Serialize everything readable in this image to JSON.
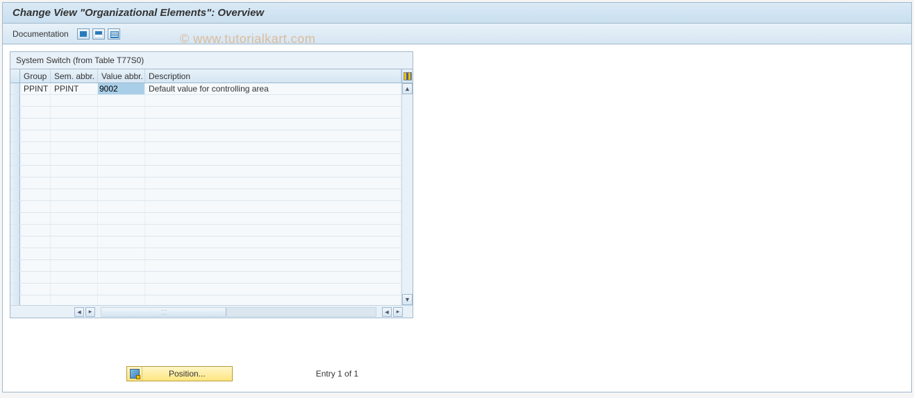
{
  "title": "Change View \"Organizational Elements\": Overview",
  "toolbar": {
    "documentation_label": "Documentation"
  },
  "watermark": "© www.tutorialkart.com",
  "panel": {
    "title": "System Switch (from Table T77S0)",
    "columns": {
      "group": "Group",
      "sem_abbr": "Sem. abbr.",
      "value_abbr": "Value abbr.",
      "description": "Description"
    },
    "rows": [
      {
        "group": "PPINT",
        "sem_abbr": "PPINT",
        "value_abbr": "9002",
        "description": "Default value for controlling area"
      }
    ],
    "empty_row_count": 18
  },
  "footer": {
    "position_button": "Position...",
    "entry_text": "Entry 1 of 1"
  }
}
